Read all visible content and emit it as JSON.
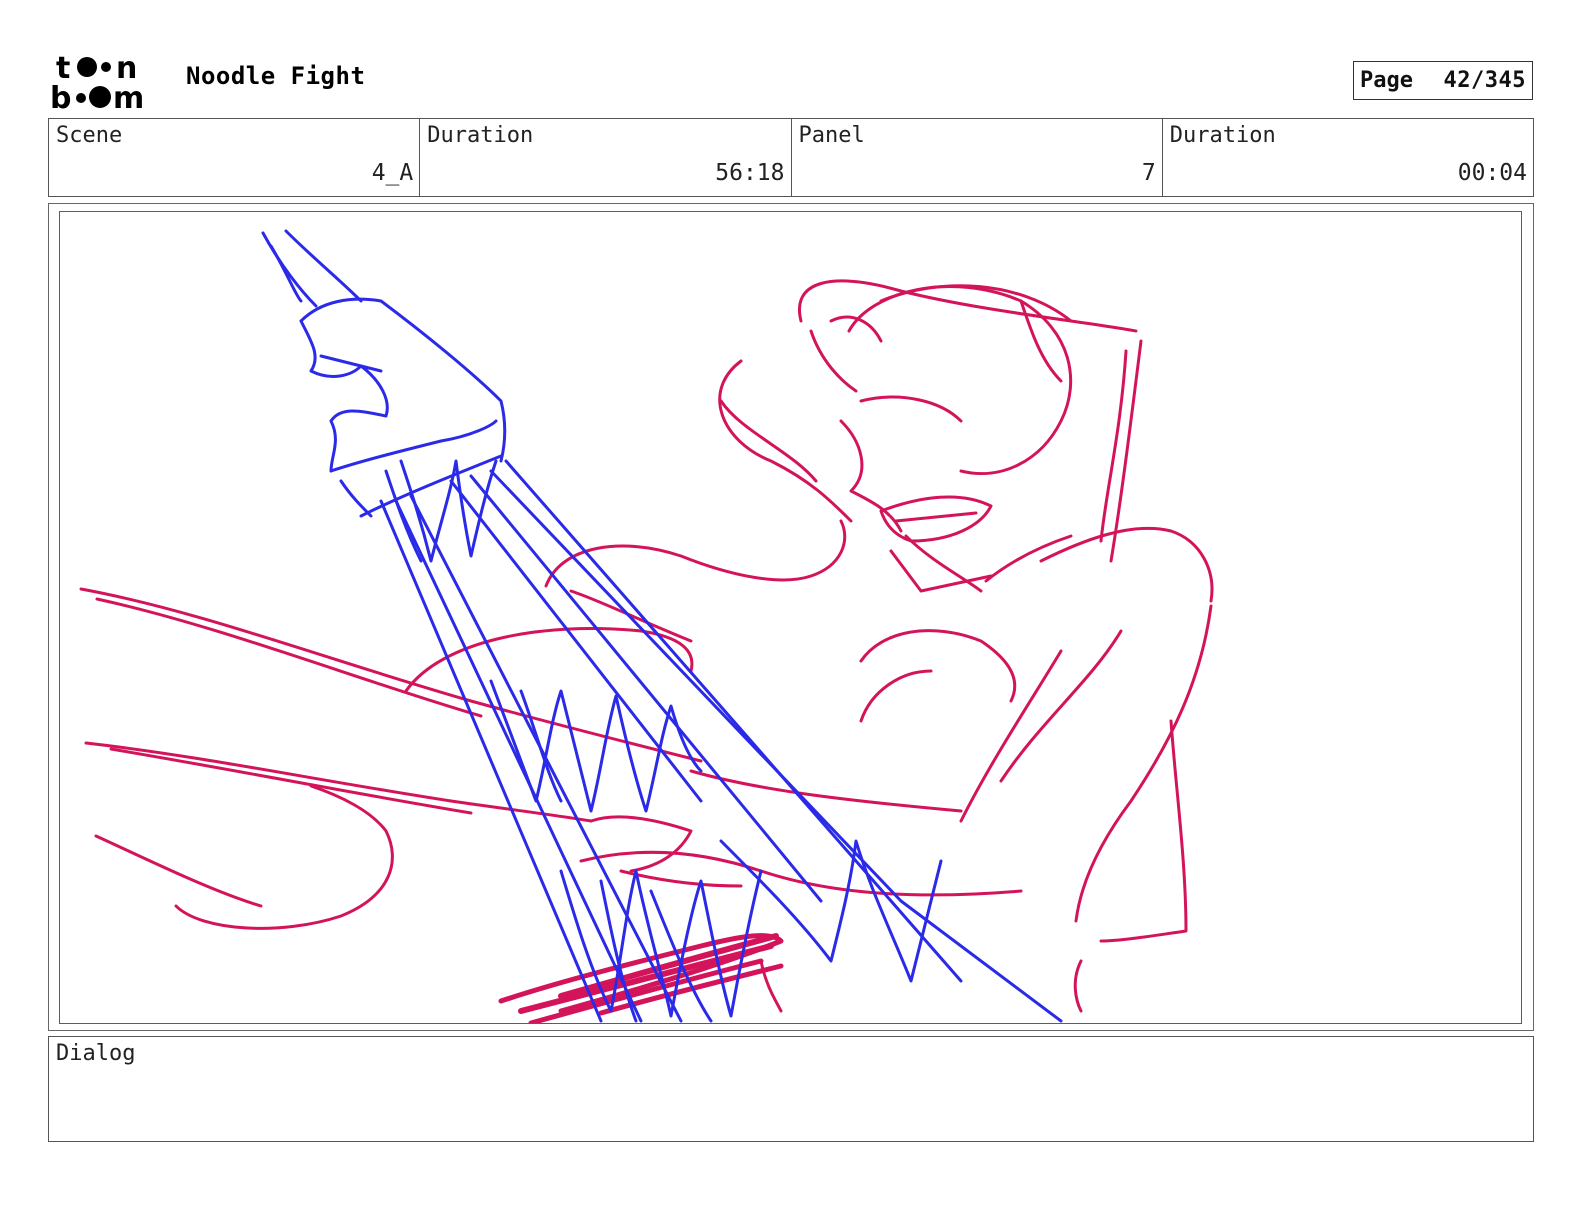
{
  "header": {
    "logo_text": "toon boom",
    "title": "Noodle Fight",
    "page_label": "Page",
    "page_number": "42/345"
  },
  "info": {
    "scene_label": "Scene",
    "scene_value": "4_A",
    "duration_label": "Duration",
    "duration_value": "56:18",
    "panel_label": "Panel",
    "panel_value": "7",
    "panel_duration_label": "Duration",
    "panel_duration_value": "00:04"
  },
  "sketch": {
    "red_stroke_color": "#d4145a",
    "blue_stroke_color": "#2a2ae8",
    "frame_color": "#2e7d32"
  },
  "dialog": {
    "label": "Dialog"
  }
}
